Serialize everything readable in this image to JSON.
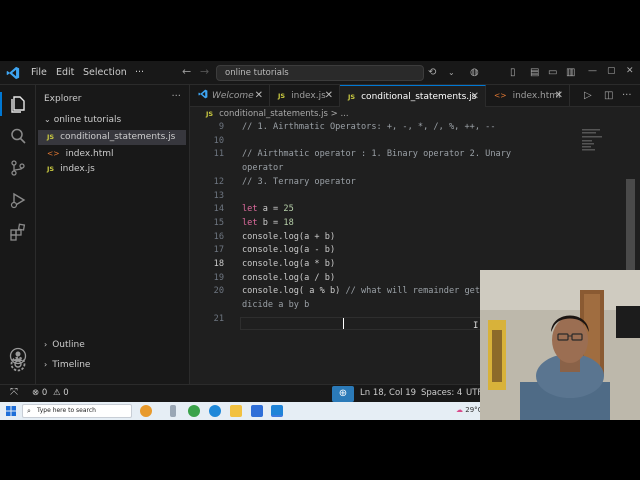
{
  "title_bar": {
    "menus": [
      "File",
      "Edit",
      "Selection"
    ],
    "more": "···",
    "search_text": "online tutorials",
    "window_controls": [
      "—",
      "▢",
      "✕"
    ]
  },
  "explorer": {
    "title": "Explorer",
    "more": "···",
    "folder": "online tutorials",
    "files": [
      {
        "badge": "JS",
        "name": "conditional_statements.js",
        "active": true
      },
      {
        "badge": "<>",
        "name": "index.html",
        "active": false
      },
      {
        "badge": "JS",
        "name": "index.js",
        "active": false
      }
    ],
    "outline_label": "Outline",
    "timeline_label": "Timeline"
  },
  "tabs": [
    {
      "label": "Welcome",
      "badge": "",
      "active": false
    },
    {
      "label": "index.js",
      "badge": "JS",
      "active": false
    },
    {
      "label": "conditional_statements.js",
      "badge": "JS",
      "active": true
    },
    {
      "label": "index.html",
      "badge": "<>",
      "active": false
    }
  ],
  "breadcrumb": {
    "file": "conditional_statements.js",
    "rest": "> ..."
  },
  "editor": {
    "current_line": 18,
    "lines": [
      {
        "n": "9",
        "text": "// 1. Airthmatic Operators: +, -, *, /, %, ++, --",
        "type": "comment"
      },
      {
        "n": "10",
        "text": "",
        "type": "blank"
      },
      {
        "n": "11",
        "text": "// Airthmatic operator : 1. Binary operator 2. Unary",
        "type": "comment"
      },
      {
        "n": "",
        "text": "operator",
        "type": "comment"
      },
      {
        "n": "12",
        "text": "// 3. Ternary operator",
        "type": "comment"
      },
      {
        "n": "13",
        "text": "",
        "type": "blank"
      },
      {
        "n": "14",
        "text": "let a = 25",
        "type": "code"
      },
      {
        "n": "15",
        "text": "let b = 18",
        "type": "code"
      },
      {
        "n": "16",
        "text": "console.log(a + b)",
        "type": "code"
      },
      {
        "n": "17",
        "text": "console.log(a - b)",
        "type": "code"
      },
      {
        "n": "18",
        "text": "console.log(a * b)",
        "type": "code"
      },
      {
        "n": "19",
        "text": "console.log(a / b)",
        "type": "code"
      },
      {
        "n": "20",
        "text": "console.log( a % b) // what will remainder get when we",
        "type": "code"
      },
      {
        "n": "",
        "text": "dicide a by b",
        "type": "comment"
      },
      {
        "n": "21",
        "text": "",
        "type": "blank"
      }
    ]
  },
  "status_bar": {
    "errors": "0",
    "warnings": "0",
    "position": "Ln 18, Col 19",
    "spaces": "Spaces: 4",
    "encoding": "UTF"
  },
  "taskbar": {
    "search_placeholder": "Type here to search",
    "weather": "29°C"
  },
  "colors": {
    "accent": "#0078d4",
    "editor_bg": "#1f1f1f",
    "keyword": "#e06c9f",
    "number": "#b5cea8",
    "comment": "#9aa0a6"
  }
}
